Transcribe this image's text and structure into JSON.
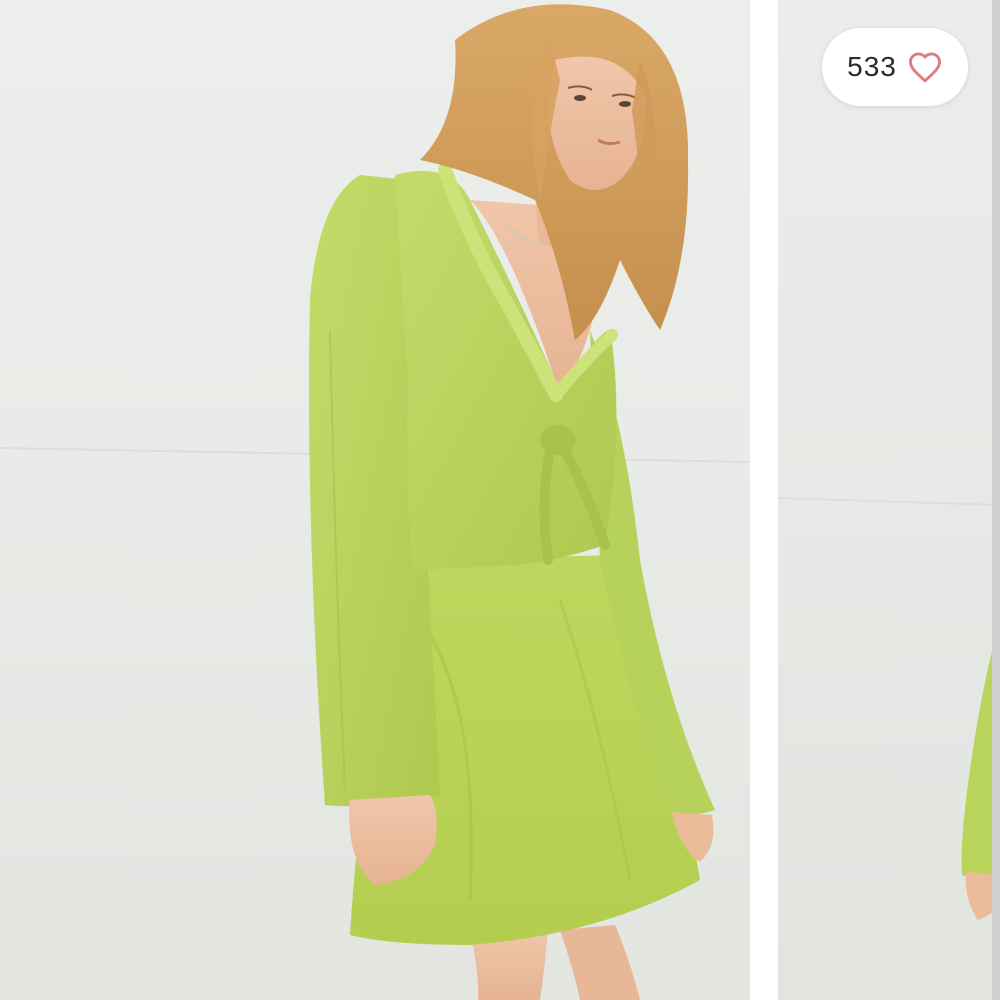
{
  "listing": {
    "like_count": "533",
    "liked": false
  },
  "icons": {
    "like": "heart-outline-icon"
  },
  "colors": {
    "heart": "#e07b7b",
    "garment": "#b9d45a",
    "background": "#eceeec",
    "badge": "#ffffff"
  },
  "carousel": {
    "images": [
      {
        "subject": "photo",
        "role": "current"
      },
      {
        "subject": "photo",
        "role": "next"
      }
    ]
  }
}
